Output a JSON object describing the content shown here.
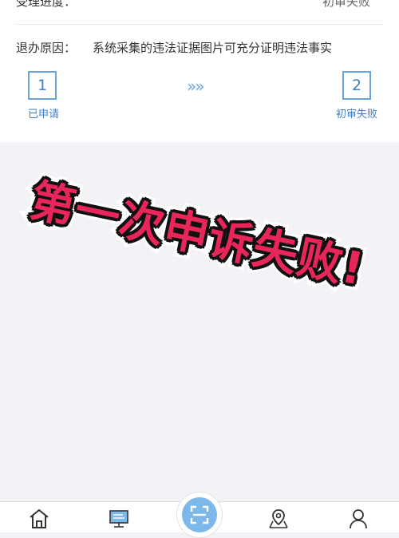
{
  "record": {
    "progress_label": "受理进度：",
    "progress_value": "初审失败",
    "reason_label": "退办原因：",
    "reason_value": "系统采集的违法证据图片可充分证明违法事实"
  },
  "steps": [
    {
      "number": "1",
      "label": "已申请"
    },
    {
      "number": "2",
      "label": "初审失败"
    }
  ],
  "arrows": "»»",
  "overlay": {
    "text": "第一次申诉失败!"
  },
  "tabbar": {
    "icons": [
      "home-icon",
      "service-icon",
      "scan-icon",
      "map-icon",
      "user-icon"
    ]
  },
  "colors": {
    "accent": "#3f7fc4",
    "overlay_red": "#e8265a",
    "scan_blue": "#7db8ea"
  }
}
